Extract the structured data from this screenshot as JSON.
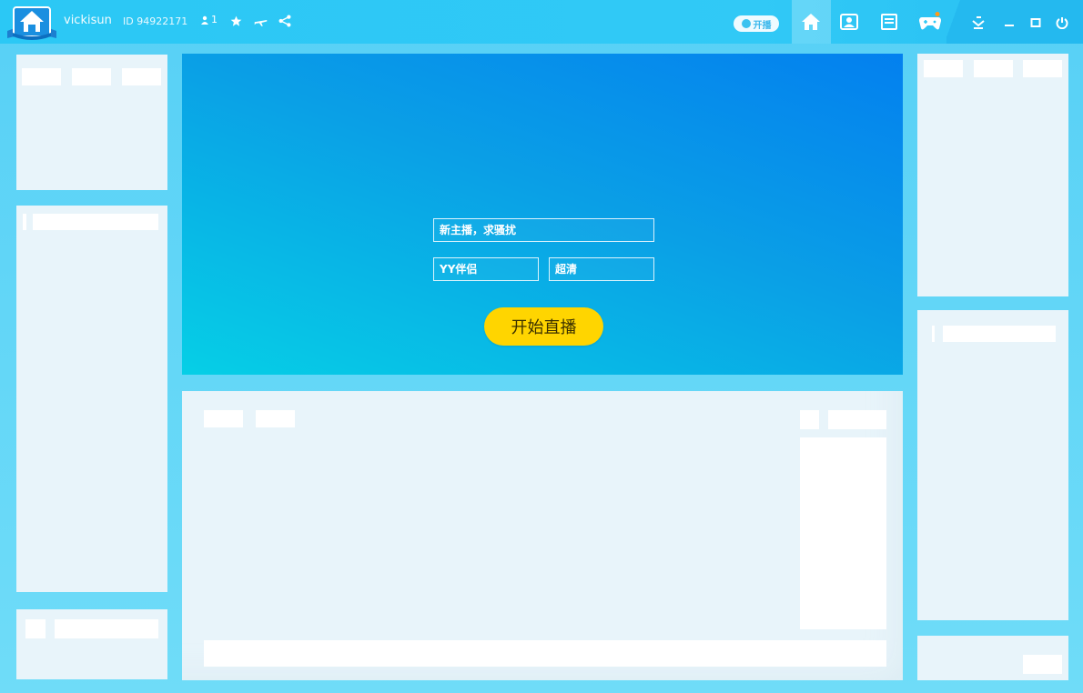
{
  "user": {
    "name": "vickisun",
    "id_label": "ID 94922171",
    "fans": "1"
  },
  "titlebar": {
    "open_badge": "开播"
  },
  "live_form": {
    "title_value": "新主播，求骚扰",
    "category_value": "YY伴侣",
    "quality_value": "超清",
    "start_button": "开始直播"
  },
  "colors": {
    "accent": "#2bc8f5",
    "start_button": "#ffd500",
    "hero_start": "#0380ef",
    "hero_end": "#06cfe6"
  }
}
